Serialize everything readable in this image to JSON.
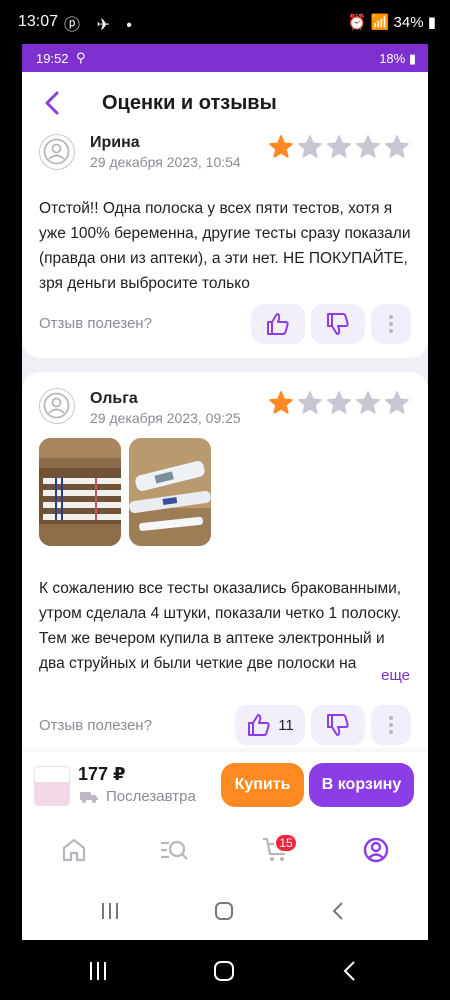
{
  "outer_status": {
    "time": "13:07",
    "battery": "34%",
    "apps": "ⓟ ✈ •"
  },
  "inner_status": {
    "time": "19:52",
    "battery": "18%"
  },
  "header": {
    "title": "Оценки и отзывы"
  },
  "reviews": [
    {
      "author": "Ирина",
      "date": "29 декабря 2023, 10:54",
      "rating": 1,
      "text": "Отстой!! Одна полоска у всех пяти тестов, хотя я уже 100% беременна, другие тесты сразу показали (правда они из аптеки), а эти нет. НЕ ПОКУПАЙТЕ, зря деньги выбросите только",
      "helpful_label": "Отзыв полезен?",
      "likes": ""
    },
    {
      "author": "Ольга",
      "date": "29 декабря 2023, 09:25",
      "rating": 1,
      "text": "К сожалению все тесты оказались бракованными, утром сделала 4 штуки, показали четко 1 полоску. Тем же вечером купила в аптеке электронный и два струйных и были четкие две полоски на",
      "more_label": "еще",
      "helpful_label": "Отзыв полезен?",
      "likes": "11"
    }
  ],
  "buybar": {
    "price": "177 ₽",
    "delivery": "Послезавтра",
    "buy_label": "Купить",
    "cart_label": "В корзину"
  },
  "tabbar": {
    "cart_badge": "15"
  },
  "colors": {
    "accent": "#8b3ee6",
    "buy": "#ff8a21",
    "star_filled": "#ff8a21",
    "star_empty": "#c9c6d3",
    "badge": "#f0263b"
  },
  "icons": [
    "back-arrow-icon",
    "avatar-icon",
    "star-icon",
    "thumbs-up-icon",
    "thumbs-down-icon",
    "more-vertical-icon",
    "truck-icon",
    "home-icon",
    "catalog-search-icon",
    "cart-icon",
    "profile-icon",
    "recents-icon",
    "home-nav-icon",
    "back-nav-icon"
  ]
}
